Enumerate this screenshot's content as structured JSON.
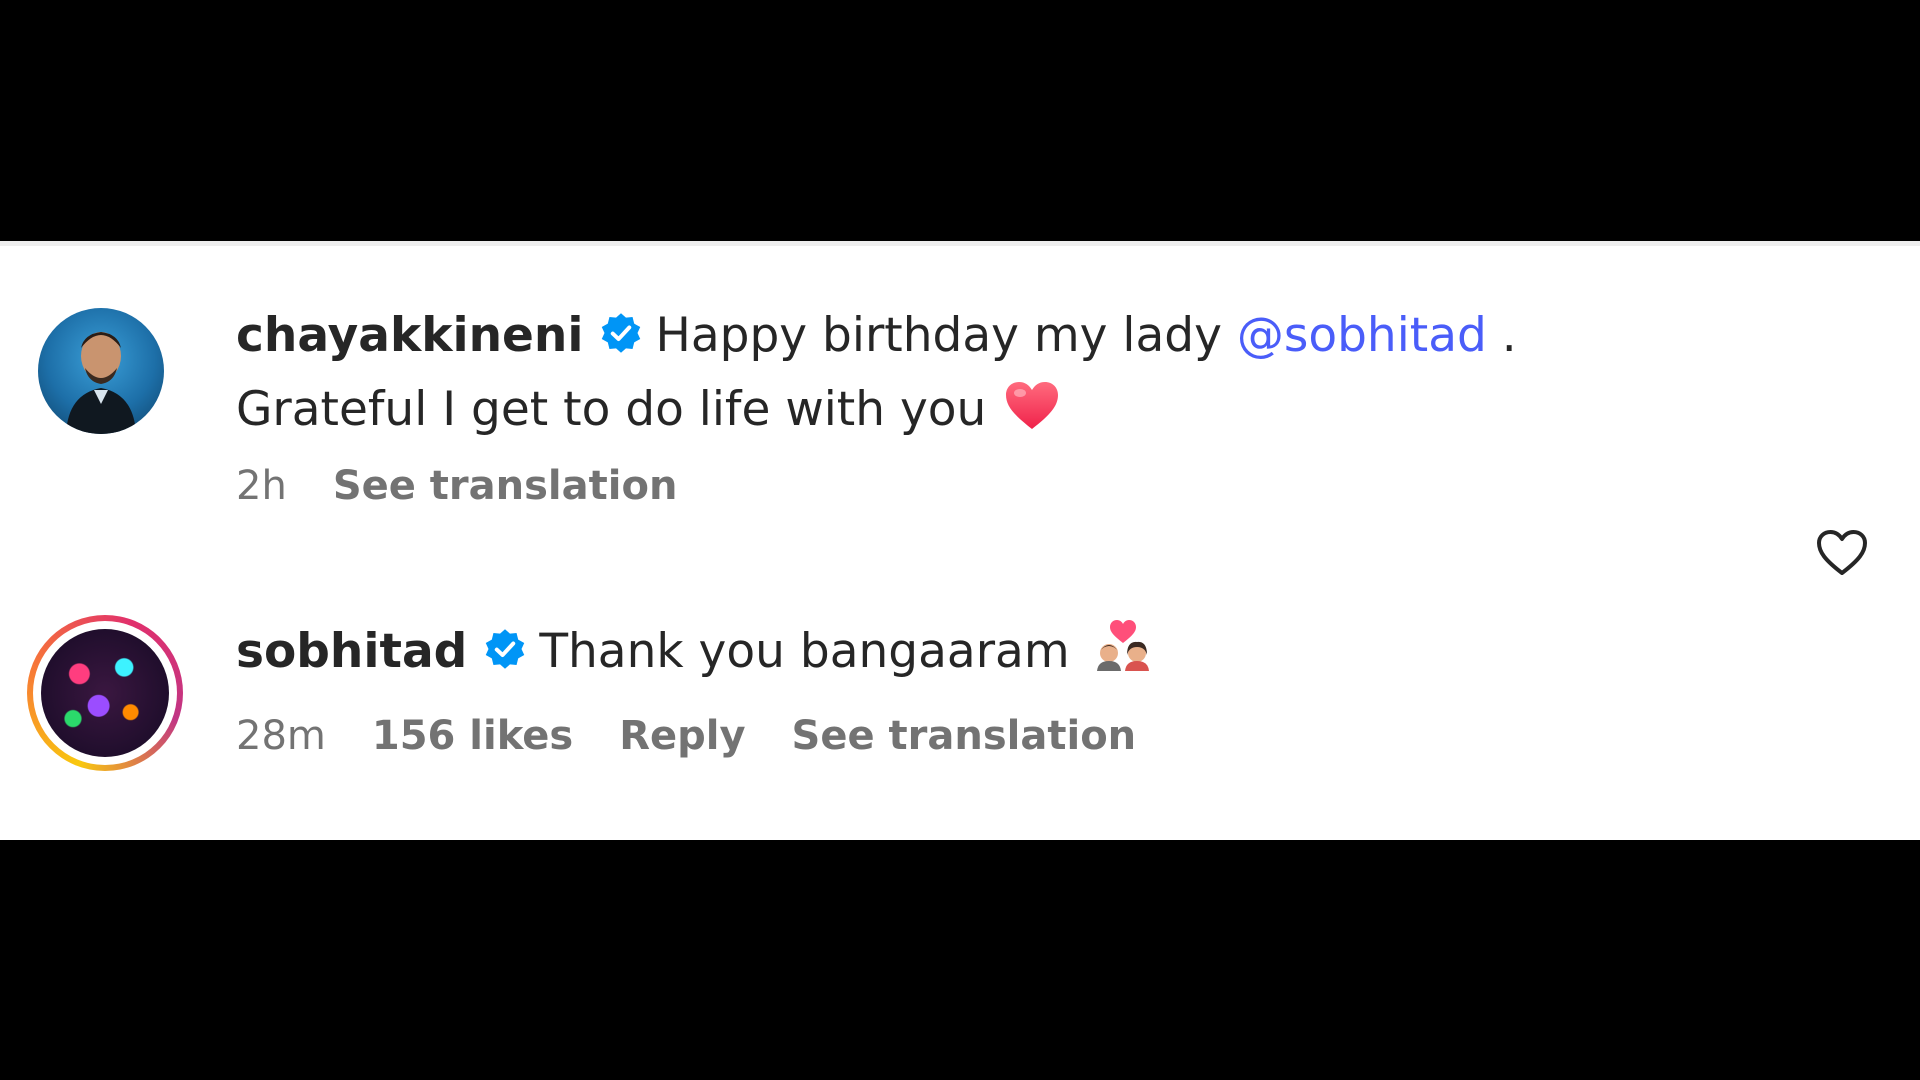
{
  "comments": [
    {
      "username": "chayakkineni",
      "verified": true,
      "text_before_mention": "Happy birthday my lady ",
      "mention": "@sobhitad",
      "text_after_mention": " . Grateful I get to do life with you",
      "emoji": "red-heart-icon",
      "time": "2h",
      "see_translation": "See translation"
    },
    {
      "username": "sobhitad",
      "verified": true,
      "text": "Thank you bangaaram",
      "emoji": "couple-with-heart-icon",
      "time": "28m",
      "likes": "156 likes",
      "reply": "Reply",
      "see_translation": "See translation",
      "like_icon": "heart-outline-icon"
    }
  ],
  "colors": {
    "mention": "#4a5df9",
    "verified_badge": "#0095f6",
    "meta_text": "#737373",
    "primary_text": "#262626",
    "heart": "#ff3b5c"
  }
}
